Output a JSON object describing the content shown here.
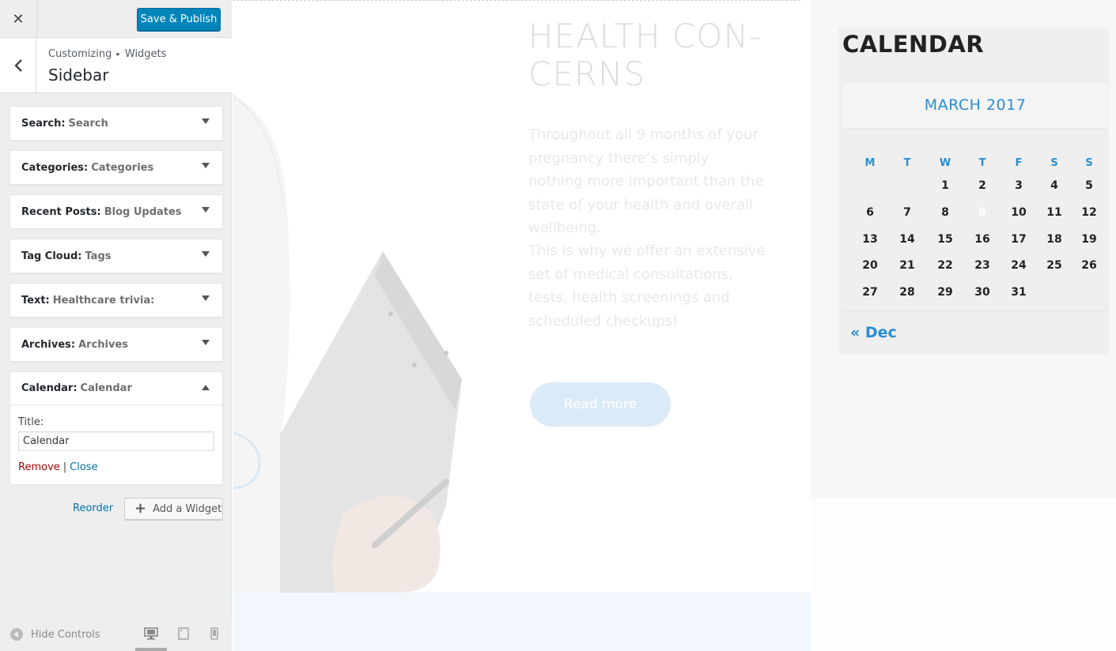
{
  "panel": {
    "close_icon": "close-icon",
    "save_publish": "Save & Publish",
    "breadcrumb": {
      "root": "Customizing",
      "separator": "▸",
      "current": "Widgets"
    },
    "section_title": "Sidebar",
    "widgets": [
      {
        "name": "Search:",
        "title": "Search"
      },
      {
        "name": "Categories:",
        "title": "Categories"
      },
      {
        "name": "Recent Posts:",
        "title": "Blog Updates"
      },
      {
        "name": "Tag Cloud:",
        "title": "Tags"
      },
      {
        "name": "Text:",
        "title": "Healthcare trivia:"
      },
      {
        "name": "Archives:",
        "title": "Archives"
      },
      {
        "name": "Calendar:",
        "title": "Calendar"
      }
    ],
    "open_widget": {
      "title_label": "Title:",
      "title_value": "Calendar",
      "remove": "Remove",
      "separator": "|",
      "close": "Close"
    },
    "reorder": "Reorder",
    "add_widget": "Add a Widget",
    "add_widget_icon": "plus-icon",
    "footer": {
      "hide_controls": "Hide Controls",
      "devices": [
        "desktop-icon",
        "tablet-icon",
        "mobile-icon"
      ],
      "active_device": "desktop"
    }
  },
  "preview": {
    "hero": {
      "title": "HEALTH CON-\nCERNS",
      "para1": "Throughout all 9 months of your pregnancy there’s simply nothing more important than the state of your health and overall wellbeing.",
      "para2": "This is why we offer an extensive set of medical consultations, tests, health screenings and scheduled checkups!",
      "read_more": "Read more"
    },
    "calendar": {
      "heading": "CALENDAR",
      "caption": "MARCH 2017",
      "weekdays": [
        "M",
        "T",
        "W",
        "T",
        "F",
        "S",
        "S"
      ],
      "weeks": [
        [
          "",
          "",
          "1",
          "2",
          "3",
          "4",
          "5"
        ],
        [
          "6",
          "7",
          "8",
          "9",
          "10",
          "11",
          "12"
        ],
        [
          "13",
          "14",
          "15",
          "16",
          "17",
          "18",
          "19"
        ],
        [
          "20",
          "21",
          "22",
          "23",
          "24",
          "25",
          "26"
        ],
        [
          "27",
          "28",
          "29",
          "30",
          "31",
          "",
          ""
        ]
      ],
      "today": "9",
      "prev_link": "« Dec"
    }
  },
  "colors": {
    "primary_button": "#0085ba",
    "link": "#0073aa",
    "remove_link": "#aa0000",
    "calendar_accent": "#2a8dd4",
    "today_circle": "#6aa8d8"
  }
}
